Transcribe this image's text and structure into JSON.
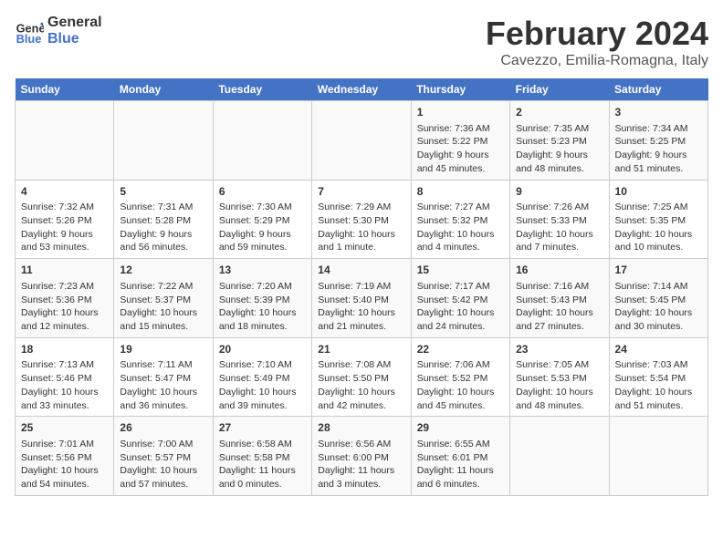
{
  "header": {
    "logo_line1": "General",
    "logo_line2": "Blue",
    "month": "February 2024",
    "location": "Cavezzo, Emilia-Romagna, Italy"
  },
  "days_of_week": [
    "Sunday",
    "Monday",
    "Tuesday",
    "Wednesday",
    "Thursday",
    "Friday",
    "Saturday"
  ],
  "weeks": [
    [
      {
        "day": "",
        "content": ""
      },
      {
        "day": "",
        "content": ""
      },
      {
        "day": "",
        "content": ""
      },
      {
        "day": "",
        "content": ""
      },
      {
        "day": "1",
        "content": "Sunrise: 7:36 AM\nSunset: 5:22 PM\nDaylight: 9 hours\nand 45 minutes."
      },
      {
        "day": "2",
        "content": "Sunrise: 7:35 AM\nSunset: 5:23 PM\nDaylight: 9 hours\nand 48 minutes."
      },
      {
        "day": "3",
        "content": "Sunrise: 7:34 AM\nSunset: 5:25 PM\nDaylight: 9 hours\nand 51 minutes."
      }
    ],
    [
      {
        "day": "4",
        "content": "Sunrise: 7:32 AM\nSunset: 5:26 PM\nDaylight: 9 hours\nand 53 minutes."
      },
      {
        "day": "5",
        "content": "Sunrise: 7:31 AM\nSunset: 5:28 PM\nDaylight: 9 hours\nand 56 minutes."
      },
      {
        "day": "6",
        "content": "Sunrise: 7:30 AM\nSunset: 5:29 PM\nDaylight: 9 hours\nand 59 minutes."
      },
      {
        "day": "7",
        "content": "Sunrise: 7:29 AM\nSunset: 5:30 PM\nDaylight: 10 hours\nand 1 minute."
      },
      {
        "day": "8",
        "content": "Sunrise: 7:27 AM\nSunset: 5:32 PM\nDaylight: 10 hours\nand 4 minutes."
      },
      {
        "day": "9",
        "content": "Sunrise: 7:26 AM\nSunset: 5:33 PM\nDaylight: 10 hours\nand 7 minutes."
      },
      {
        "day": "10",
        "content": "Sunrise: 7:25 AM\nSunset: 5:35 PM\nDaylight: 10 hours\nand 10 minutes."
      }
    ],
    [
      {
        "day": "11",
        "content": "Sunrise: 7:23 AM\nSunset: 5:36 PM\nDaylight: 10 hours\nand 12 minutes."
      },
      {
        "day": "12",
        "content": "Sunrise: 7:22 AM\nSunset: 5:37 PM\nDaylight: 10 hours\nand 15 minutes."
      },
      {
        "day": "13",
        "content": "Sunrise: 7:20 AM\nSunset: 5:39 PM\nDaylight: 10 hours\nand 18 minutes."
      },
      {
        "day": "14",
        "content": "Sunrise: 7:19 AM\nSunset: 5:40 PM\nDaylight: 10 hours\nand 21 minutes."
      },
      {
        "day": "15",
        "content": "Sunrise: 7:17 AM\nSunset: 5:42 PM\nDaylight: 10 hours\nand 24 minutes."
      },
      {
        "day": "16",
        "content": "Sunrise: 7:16 AM\nSunset: 5:43 PM\nDaylight: 10 hours\nand 27 minutes."
      },
      {
        "day": "17",
        "content": "Sunrise: 7:14 AM\nSunset: 5:45 PM\nDaylight: 10 hours\nand 30 minutes."
      }
    ],
    [
      {
        "day": "18",
        "content": "Sunrise: 7:13 AM\nSunset: 5:46 PM\nDaylight: 10 hours\nand 33 minutes."
      },
      {
        "day": "19",
        "content": "Sunrise: 7:11 AM\nSunset: 5:47 PM\nDaylight: 10 hours\nand 36 minutes."
      },
      {
        "day": "20",
        "content": "Sunrise: 7:10 AM\nSunset: 5:49 PM\nDaylight: 10 hours\nand 39 minutes."
      },
      {
        "day": "21",
        "content": "Sunrise: 7:08 AM\nSunset: 5:50 PM\nDaylight: 10 hours\nand 42 minutes."
      },
      {
        "day": "22",
        "content": "Sunrise: 7:06 AM\nSunset: 5:52 PM\nDaylight: 10 hours\nand 45 minutes."
      },
      {
        "day": "23",
        "content": "Sunrise: 7:05 AM\nSunset: 5:53 PM\nDaylight: 10 hours\nand 48 minutes."
      },
      {
        "day": "24",
        "content": "Sunrise: 7:03 AM\nSunset: 5:54 PM\nDaylight: 10 hours\nand 51 minutes."
      }
    ],
    [
      {
        "day": "25",
        "content": "Sunrise: 7:01 AM\nSunset: 5:56 PM\nDaylight: 10 hours\nand 54 minutes."
      },
      {
        "day": "26",
        "content": "Sunrise: 7:00 AM\nSunset: 5:57 PM\nDaylight: 10 hours\nand 57 minutes."
      },
      {
        "day": "27",
        "content": "Sunrise: 6:58 AM\nSunset: 5:58 PM\nDaylight: 11 hours\nand 0 minutes."
      },
      {
        "day": "28",
        "content": "Sunrise: 6:56 AM\nSunset: 6:00 PM\nDaylight: 11 hours\nand 3 minutes."
      },
      {
        "day": "29",
        "content": "Sunrise: 6:55 AM\nSunset: 6:01 PM\nDaylight: 11 hours\nand 6 minutes."
      },
      {
        "day": "",
        "content": ""
      },
      {
        "day": "",
        "content": ""
      }
    ]
  ]
}
